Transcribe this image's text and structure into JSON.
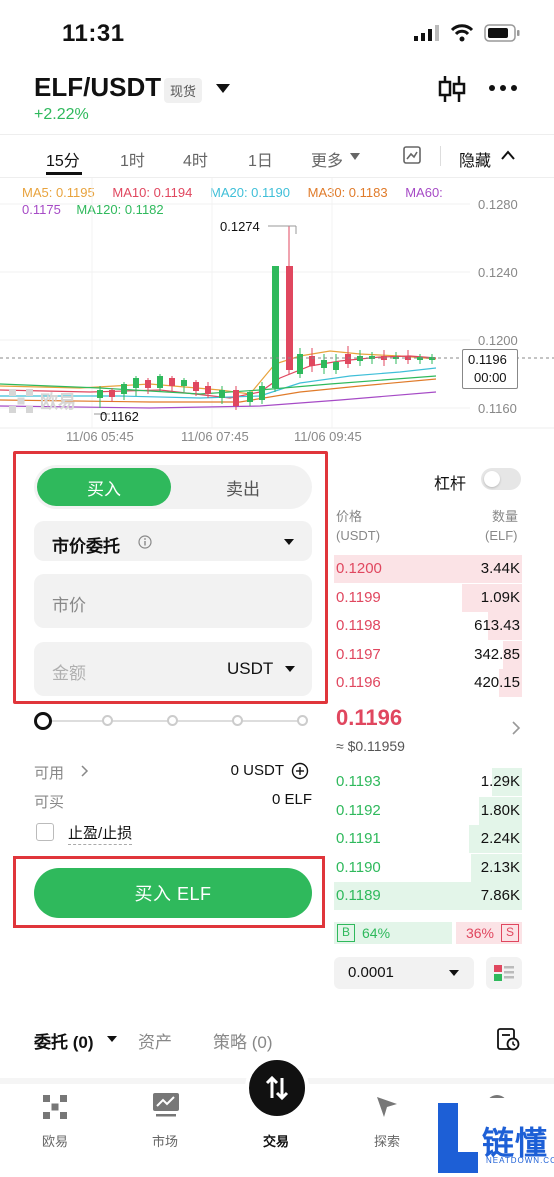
{
  "status": {
    "time": "11:31"
  },
  "header": {
    "pair": "ELF/USDT",
    "badge": "现货",
    "change": "+2.22%"
  },
  "timeframes": [
    "15分",
    "1时",
    "4时",
    "1日",
    "更多"
  ],
  "hide_label": "隐藏",
  "chart": {
    "ma": {
      "ma5": "MA5: 0.1195",
      "ma10": "MA10: 0.1194",
      "ma20": "MA20: 0.1190",
      "ma30": "MA30: 0.1183",
      "ma60a": "MA60:",
      "ma60b": "0.1175",
      "ma120": "MA120: 0.1182"
    },
    "colors": {
      "ma5": "#e8a33d",
      "ma10": "#e0475f",
      "ma20": "#3fbfd8",
      "ma30": "#e07b2a",
      "ma60": "#a64bc6",
      "ma120": "#2fb95c"
    },
    "y_ticks": [
      "0.1280",
      "0.1240",
      "0.1200",
      "0.1160"
    ],
    "x_ticks": [
      "11/06 05:45",
      "11/06 07:45",
      "11/06 09:45"
    ],
    "high_label": "0.1274",
    "low_label": "0.1162",
    "last_price": "0.1196",
    "last_time": "00:00",
    "watermark": "欧易"
  },
  "form": {
    "buy_tab": "买入",
    "sell_tab": "卖出",
    "order_type": "市价委托",
    "price_text": "市价",
    "amount_placeholder": "金额",
    "amount_unit": "USDT",
    "available_label": "可用",
    "available_value": "0 USDT",
    "can_buy_label": "可买",
    "can_buy_value": "0 ELF",
    "tp_sl_label": "止盈/止损",
    "buy_button": "买入 ELF",
    "slider_percent": 0
  },
  "orderbook": {
    "leverage_label": "杠杆",
    "price_header": "价格",
    "price_unit": "(USDT)",
    "qty_header": "数量",
    "qty_unit": "(ELF)",
    "asks": [
      {
        "price": "0.1200",
        "qty": "3.44K",
        "depth": 1.0
      },
      {
        "price": "0.1199",
        "qty": "1.09K",
        "depth": 0.32
      },
      {
        "price": "0.1198",
        "qty": "613.43",
        "depth": 0.18
      },
      {
        "price": "0.1197",
        "qty": "342.85",
        "depth": 0.1
      },
      {
        "price": "0.1196",
        "qty": "420.15",
        "depth": 0.12
      }
    ],
    "mid_price": "0.1196",
    "mid_usd": "≈ $0.11959",
    "bids": [
      {
        "price": "0.1193",
        "qty": "1.29K",
        "depth": 0.16
      },
      {
        "price": "0.1192",
        "qty": "1.80K",
        "depth": 0.23
      },
      {
        "price": "0.1191",
        "qty": "2.24K",
        "depth": 0.28
      },
      {
        "price": "0.1190",
        "qty": "2.13K",
        "depth": 0.27
      },
      {
        "price": "0.1189",
        "qty": "7.86K",
        "depth": 1.0
      }
    ],
    "buy_ratio_letter": "B",
    "buy_ratio": "64%",
    "sell_ratio": "36%",
    "sell_ratio_letter": "S",
    "buy_ratio_value": 64,
    "depth_value": "0.0001"
  },
  "bottom_tabs": {
    "orders": "委托 (0)",
    "assets": "资产",
    "strategy": "策略 (0)"
  },
  "nav": [
    "欧易",
    "市场",
    "交易",
    "探索"
  ],
  "watermark": {
    "text": "链懂",
    "sub": "NEATDOWN.COM"
  }
}
